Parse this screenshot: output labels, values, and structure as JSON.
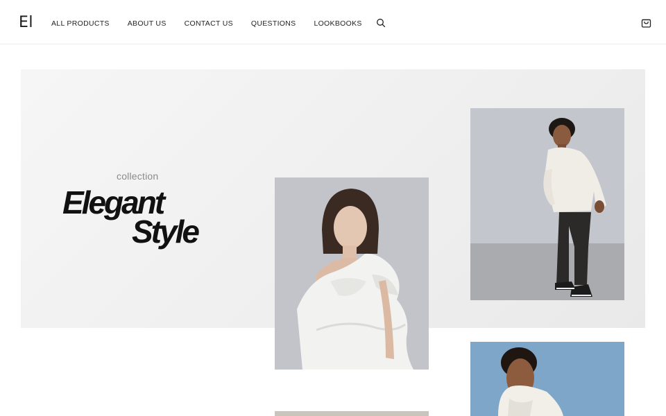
{
  "header": {
    "logo": "El",
    "nav": {
      "all_products": "ALL PRODUCTS",
      "about_us": "ABOUT US",
      "contact_us": "CONTACT US",
      "questions": "QUESTIONS",
      "lookbooks": "LOOKBOOKS"
    },
    "icons": {
      "search": "search-icon",
      "cart": "shopping-bag-icon"
    }
  },
  "hero": {
    "subtitle": "collection",
    "title_line_1": "Elegant",
    "title_line_2": "Style"
  },
  "gallery": {
    "photos": [
      "woman-white-ruffle-dress-photo",
      "man-cream-jacket-standing-photo",
      "man-white-hoodie-blue-background-photo",
      "beige-product-photo"
    ]
  },
  "colors": {
    "text": "#1a1a1a",
    "hero_background": "#f1f1f1",
    "subtitle": "#8a8a8a",
    "border": "#ececec"
  }
}
